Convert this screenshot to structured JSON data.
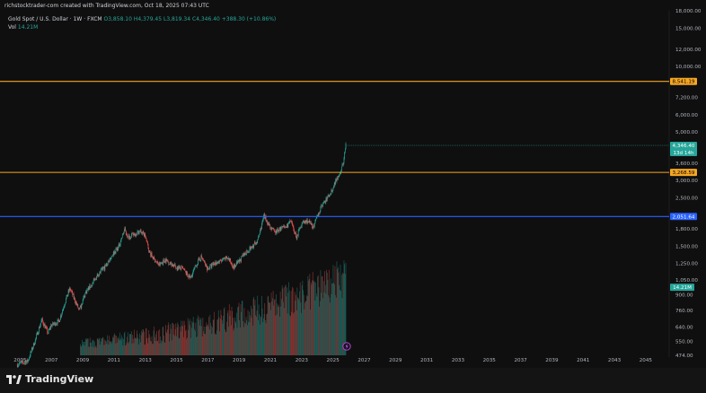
{
  "header": {
    "author_line": "richstocktrader-com created with TradingView.com, Oct 18, 2025 07:43 UTC",
    "symbol": "Gold Spot / U.S. Dollar · 1W · FXCM",
    "ohlc": "O3,858.10  H4,379.45  L3,819.34  C4,346.40  +388.30 (+10.86%)",
    "vol_label": "Vol",
    "vol_value": "14.21M"
  },
  "footer": {
    "brand": "TradingView"
  },
  "colors": {
    "background": "#0f0f0f",
    "up": "#26a69a",
    "down": "#ef5350",
    "orange_line": "#f5a623",
    "blue_line": "#2962ff"
  },
  "chart_data": {
    "type": "candlestick",
    "scale": "log",
    "ylim": [
      474,
      18000
    ],
    "xlim": [
      2004.0,
      2046.5
    ],
    "y_ticks": [
      18000,
      15000,
      12000,
      10000,
      7200,
      6000,
      5000,
      3600,
      3000,
      2500,
      1800,
      1500,
      1250,
      1050,
      900,
      760,
      640,
      550,
      474
    ],
    "y_tick_labels": [
      "18,000.00",
      "15,000.00",
      "12,000.00",
      "10,000.00",
      "7,200.00",
      "6,000.00",
      "5,000.00",
      "3,600.00",
      "3,000.00",
      "2,500.00",
      "1,800.00",
      "1,500.00",
      "1,250.00",
      "1,050.00",
      "900.00",
      "760.00",
      "640.00",
      "550.00",
      "474.00"
    ],
    "x_ticks": [
      "2005",
      "2007",
      "2009",
      "2011",
      "2013",
      "2015",
      "2017",
      "2019",
      "2021",
      "2023",
      "2025",
      "2027",
      "2029",
      "2031",
      "2033",
      "2035",
      "2037",
      "2039",
      "2041",
      "2043",
      "2045"
    ],
    "x_tick_years": [
      2005,
      2007,
      2009,
      2011,
      2013,
      2015,
      2017,
      2019,
      2021,
      2023,
      2025,
      2027,
      2029,
      2031,
      2033,
      2035,
      2037,
      2039,
      2041,
      2043,
      2045
    ],
    "price_path": [
      [
        2004.8,
        430
      ],
      [
        2005.5,
        445
      ],
      [
        2006.0,
        560
      ],
      [
        2006.4,
        690
      ],
      [
        2006.8,
        600
      ],
      [
        2007.0,
        650
      ],
      [
        2007.5,
        680
      ],
      [
        2008.0,
        880
      ],
      [
        2008.2,
        960
      ],
      [
        2008.8,
        760
      ],
      [
        2009.2,
        920
      ],
      [
        2009.6,
        1000
      ],
      [
        2010.0,
        1110
      ],
      [
        2010.5,
        1220
      ],
      [
        2010.9,
        1370
      ],
      [
        2011.3,
        1480
      ],
      [
        2011.7,
        1800
      ],
      [
        2011.9,
        1650
      ],
      [
        2012.3,
        1700
      ],
      [
        2012.7,
        1760
      ],
      [
        2013.0,
        1680
      ],
      [
        2013.3,
        1400
      ],
      [
        2013.6,
        1300
      ],
      [
        2013.9,
        1230
      ],
      [
        2014.3,
        1300
      ],
      [
        2014.7,
        1240
      ],
      [
        2015.0,
        1200
      ],
      [
        2015.4,
        1180
      ],
      [
        2015.9,
        1070
      ],
      [
        2016.3,
        1240
      ],
      [
        2016.6,
        1340
      ],
      [
        2017.0,
        1180
      ],
      [
        2017.5,
        1260
      ],
      [
        2017.9,
        1280
      ],
      [
        2018.3,
        1330
      ],
      [
        2018.7,
        1200
      ],
      [
        2019.1,
        1300
      ],
      [
        2019.5,
        1420
      ],
      [
        2019.9,
        1500
      ],
      [
        2020.2,
        1580
      ],
      [
        2020.6,
        2060
      ],
      [
        2021.0,
        1850
      ],
      [
        2021.3,
        1730
      ],
      [
        2021.6,
        1800
      ],
      [
        2022.0,
        1830
      ],
      [
        2022.3,
        1950
      ],
      [
        2022.7,
        1650
      ],
      [
        2023.0,
        1900
      ],
      [
        2023.4,
        1960
      ],
      [
        2023.8,
        1830
      ],
      [
        2024.0,
        2040
      ],
      [
        2024.3,
        2300
      ],
      [
        2024.6,
        2450
      ],
      [
        2024.9,
        2650
      ],
      [
        2025.2,
        3000
      ],
      [
        2025.5,
        3300
      ],
      [
        2025.7,
        3650
      ],
      [
        2025.82,
        4346
      ]
    ],
    "candle_width_years": 0.0384,
    "volume_start_year": 2008.8,
    "volume_max": 14.21,
    "horizontal_levels": [
      {
        "value": 8541.19,
        "label": "8,541.19",
        "color": "#f5a623"
      },
      {
        "value": 3268.59,
        "label": "3,268.59",
        "color": "#f5a623"
      },
      {
        "value": 2051.64,
        "label": "2,051.64",
        "color": "#2962ff"
      }
    ],
    "last_price": {
      "value": 4346.4,
      "label": "4,346.40",
      "countdown": "13d 14h"
    },
    "volume_badge": {
      "value": 14.21,
      "label": "14.21M"
    }
  }
}
